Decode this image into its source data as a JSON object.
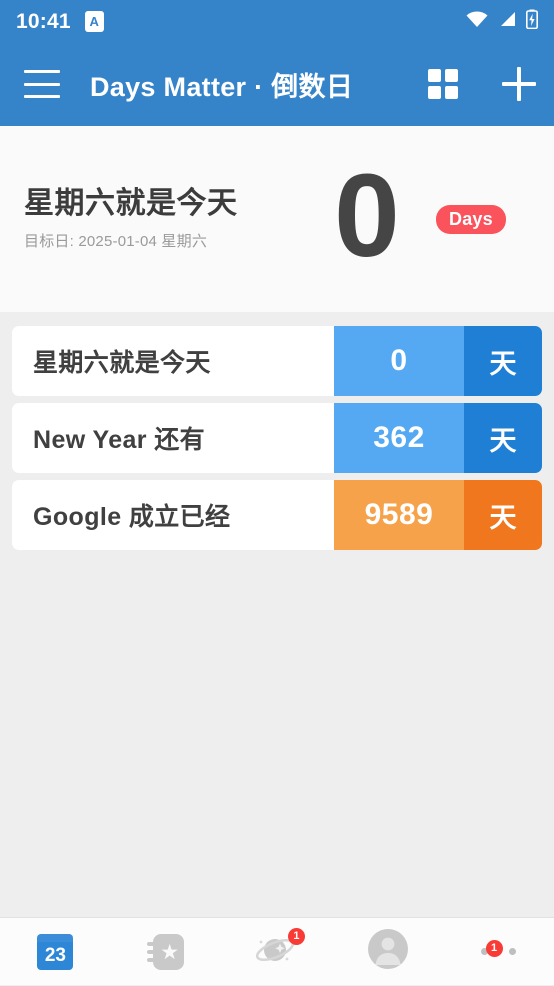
{
  "status_bar": {
    "time": "10:41",
    "notification_icon_letter": "A",
    "icons": [
      "wifi-icon",
      "cellular-signal-icon",
      "battery-charging-icon"
    ]
  },
  "app_bar": {
    "menu_icon": "hamburger-menu-icon",
    "title": "Days Matter · 倒数日",
    "grid_icon": "grid-view-icon",
    "add_icon": "plus-add-icon"
  },
  "featured": {
    "title": "星期六就是今天",
    "subtitle": "目标日: 2025-01-04 星期六",
    "count": "0",
    "badge_label": "Days",
    "badge_color": "#FA535B",
    "background": "#FAFAFA"
  },
  "events": [
    {
      "name": "星期六就是今天",
      "count": "0",
      "unit": "天",
      "count_color": "#55A8F2",
      "unit_color": "#1E7FD4"
    },
    {
      "name": "New Year 还有",
      "count": "362",
      "unit": "天",
      "count_color": "#55A8F2",
      "unit_color": "#1E7FD4"
    },
    {
      "name": "Google 成立已经",
      "count": "9589",
      "unit": "天",
      "count_color": "#F5A24B",
      "unit_color": "#F0771D"
    }
  ],
  "bottom_nav": [
    {
      "icon": "calendar-icon",
      "day_number": "23",
      "active": true,
      "badge": ""
    },
    {
      "icon": "notebook-star-icon",
      "active": false,
      "badge": ""
    },
    {
      "icon": "planet-discover-icon",
      "active": false,
      "badge": "1"
    },
    {
      "icon": "user-avatar-icon",
      "active": false,
      "badge": ""
    },
    {
      "icon": "more-dots-icon",
      "active": false,
      "badge": "1"
    }
  ]
}
